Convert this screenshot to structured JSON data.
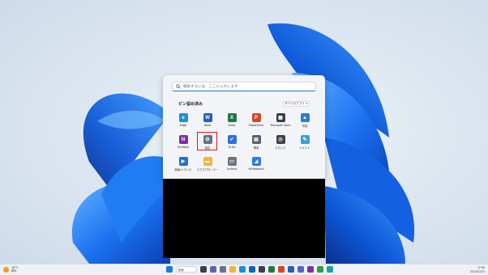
{
  "start_menu": {
    "search_placeholder": "検索するには、ここに入力します",
    "pinned_title": "ピン留め済み",
    "all_apps_label": "すべてのアプリ  >",
    "apps": [
      {
        "label": "Edge",
        "icon": "edge-icon",
        "color": "#1b8fd9",
        "glyph": "e"
      },
      {
        "label": "Word",
        "icon": "word-icon",
        "color": "#1f5fbf",
        "glyph": "W"
      },
      {
        "label": "Excel",
        "icon": "excel-icon",
        "color": "#1d7a43",
        "glyph": "X"
      },
      {
        "label": "PowerPoint",
        "icon": "powerpoint-icon",
        "color": "#d24625",
        "glyph": "P"
      },
      {
        "label": "Microsoft Store",
        "icon": "store-icon",
        "color": "#3a3f4a",
        "glyph": "▦"
      },
      {
        "label": "写真",
        "icon": "photos-icon",
        "color": "#2a7dd6",
        "glyph": "▲"
      },
      {
        "label": "OneNote",
        "icon": "onenote-icon",
        "color": "#7b2fa8",
        "glyph": "N"
      },
      {
        "label": "設定",
        "icon": "gear-icon",
        "color": "#6b7380",
        "glyph": "⚙"
      },
      {
        "label": "To Do",
        "icon": "todo-icon",
        "color": "#2e6fe0",
        "glyph": "✔"
      },
      {
        "label": "電卓",
        "icon": "calculator-icon",
        "color": "#5a6170",
        "glyph": "▤"
      },
      {
        "label": "クロック",
        "icon": "clock-icon",
        "color": "#3b4252",
        "glyph": "◷"
      },
      {
        "label": "ペイント",
        "icon": "paint-icon",
        "color": "#3aa0d8",
        "glyph": "✎"
      },
      {
        "label": "映画 & テレビ",
        "icon": "movies-icon",
        "color": "#1f6fd1",
        "glyph": "▶"
      },
      {
        "label": "エクスプローラー",
        "icon": "folder-icon",
        "color": "#f2b53a",
        "glyph": "▬"
      },
      {
        "label": "Surface",
        "icon": "surface-icon",
        "color": "#6a7584",
        "glyph": "▭"
      },
      {
        "label": "Whiteboard",
        "icon": "whiteboard-icon",
        "color": "#2c7be0",
        "glyph": "◢"
      }
    ]
  },
  "taskbar": {
    "weather_temp": "18°C",
    "weather_desc": "晴れ",
    "search_label": "検索",
    "time": "12:56",
    "date": "2023/07/23",
    "pinned": [
      {
        "name": "start-button",
        "color": "#1a7ad6"
      },
      {
        "name": "task-view-icon",
        "color": "#3a3f4a"
      },
      {
        "name": "chat-icon",
        "color": "#6264a7"
      },
      {
        "name": "settings-taskbar-icon",
        "color": "#6b7380"
      },
      {
        "name": "explorer-icon",
        "color": "#f2b53a"
      },
      {
        "name": "edge-taskbar-icon",
        "color": "#1b8fd9"
      },
      {
        "name": "outlook-icon",
        "color": "#0a64c0"
      },
      {
        "name": "store-taskbar-icon",
        "color": "#3a3f4a"
      },
      {
        "name": "excel-taskbar-icon",
        "color": "#1d7a43"
      },
      {
        "name": "powerpoint-taskbar-icon",
        "color": "#d24625"
      },
      {
        "name": "word-taskbar-icon",
        "color": "#1f5fbf"
      },
      {
        "name": "teams-icon",
        "color": "#5b5fc7"
      },
      {
        "name": "onenote-taskbar-icon",
        "color": "#7b2fa8"
      },
      {
        "name": "chrome-icon",
        "color": "#2f9e44"
      },
      {
        "name": "app-taskbar-icon",
        "color": "#1ea0a8"
      }
    ]
  }
}
